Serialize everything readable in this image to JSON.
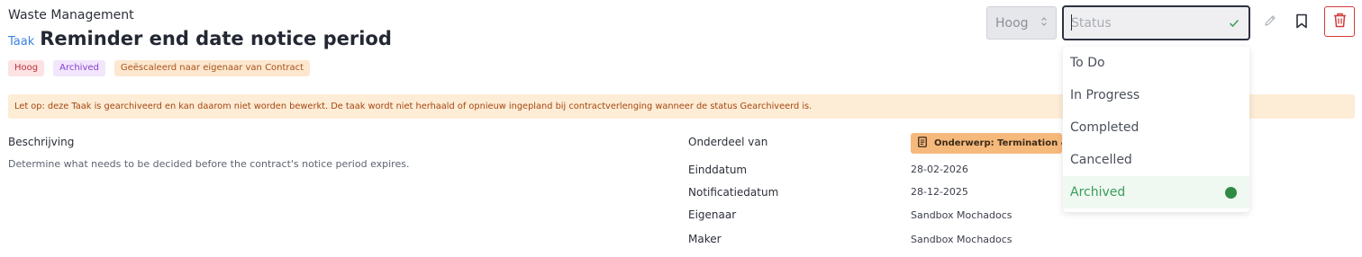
{
  "header": {
    "project": "Waste Management",
    "type_label": "Taak",
    "title": "Reminder end date notice period"
  },
  "badges": [
    "Hoog",
    "Archived",
    "Geëscaleerd naar eigenaar van Contract"
  ],
  "warning": "Let op: deze Taak is gearchiveerd en kan daarom niet worden bewerkt. De taak wordt niet herhaald of opnieuw ingepland bij contractverlenging wanneer de status Gearchiveerd is.",
  "description": {
    "label": "Beschrijving",
    "text": "Determine what needs to be decided before the contract's notice period expires."
  },
  "details": {
    "part_of_label": "Onderdeel van",
    "part_of_value": "Onderwerp: Termination & R",
    "end_date_label": "Einddatum",
    "end_date_value": "28-02-2026",
    "notification_label": "Notificatiedatum",
    "notification_value": "28-12-2025",
    "owner_label": "Eigenaar",
    "owner_value": "Sandbox Mochadocs",
    "creator_label": "Maker",
    "creator_value": "Sandbox Mochadocs"
  },
  "toolbar": {
    "priority_value": "Hoog",
    "status_placeholder": "Status"
  },
  "status_options": [
    "To Do",
    "In Progress",
    "Completed",
    "Cancelled",
    "Archived"
  ],
  "selected_status": "Archived",
  "icons": {
    "priority_arrows": "unfold-icon",
    "status_check": "check-icon",
    "edit": "pencil-icon",
    "bookmark": "bookmark-icon",
    "delete": "trash-icon",
    "subject": "document-icon"
  },
  "colors": {
    "link": "#3b82e6",
    "warning_bg": "#fdecd6",
    "selected_green": "#2f8a46",
    "delete_red": "#d23a3a"
  }
}
